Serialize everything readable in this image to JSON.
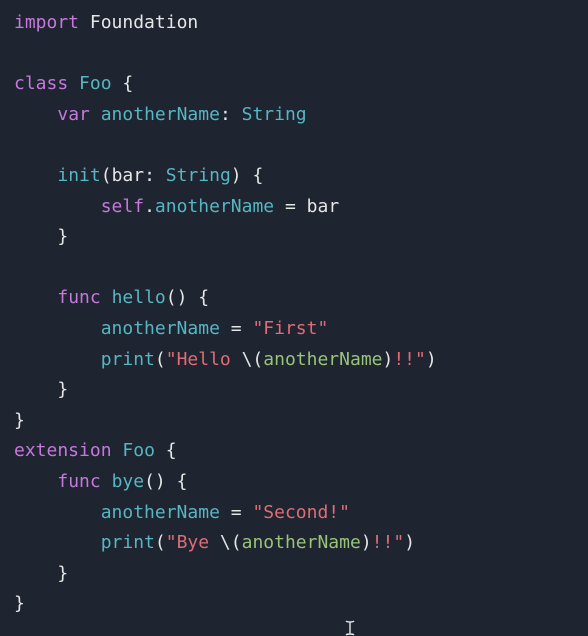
{
  "code": {
    "lines": [
      [
        {
          "t": "import",
          "c": "#c678dd"
        },
        {
          "t": " ",
          "c": "#e6e6e6"
        },
        {
          "t": "Foundation",
          "c": "#e6e6e6"
        }
      ],
      [],
      [
        {
          "t": "class",
          "c": "#c678dd"
        },
        {
          "t": " ",
          "c": "#e6e6e6"
        },
        {
          "t": "Foo",
          "c": "#56b6c2"
        },
        {
          "t": " ",
          "c": "#e6e6e6"
        },
        {
          "t": "{",
          "c": "#e6e6e6"
        }
      ],
      [
        {
          "t": "    ",
          "c": "#e6e6e6"
        },
        {
          "t": "var",
          "c": "#c678dd"
        },
        {
          "t": " ",
          "c": "#e6e6e6"
        },
        {
          "t": "anotherName",
          "c": "#56b6c2"
        },
        {
          "t": ": ",
          "c": "#e6e6e6"
        },
        {
          "t": "String",
          "c": "#56b6c2"
        }
      ],
      [],
      [
        {
          "t": "    ",
          "c": "#e6e6e6"
        },
        {
          "t": "init",
          "c": "#56b6c2"
        },
        {
          "t": "(",
          "c": "#e6e6e6"
        },
        {
          "t": "bar",
          "c": "#e6e6e6"
        },
        {
          "t": ": ",
          "c": "#e6e6e6"
        },
        {
          "t": "String",
          "c": "#56b6c2"
        },
        {
          "t": ") {",
          "c": "#e6e6e6"
        }
      ],
      [
        {
          "t": "        ",
          "c": "#e6e6e6"
        },
        {
          "t": "self",
          "c": "#c678dd"
        },
        {
          "t": ".",
          "c": "#e6e6e6"
        },
        {
          "t": "anotherName",
          "c": "#56b6c2"
        },
        {
          "t": " = ",
          "c": "#e6e6e6"
        },
        {
          "t": "bar",
          "c": "#e6e6e6"
        }
      ],
      [
        {
          "t": "    }",
          "c": "#e6e6e6"
        }
      ],
      [],
      [
        {
          "t": "    ",
          "c": "#e6e6e6"
        },
        {
          "t": "func",
          "c": "#c678dd"
        },
        {
          "t": " ",
          "c": "#e6e6e6"
        },
        {
          "t": "hello",
          "c": "#56b6c2"
        },
        {
          "t": "() {",
          "c": "#e6e6e6"
        }
      ],
      [
        {
          "t": "        ",
          "c": "#e6e6e6"
        },
        {
          "t": "anotherName",
          "c": "#56b6c2"
        },
        {
          "t": " = ",
          "c": "#e6e6e6"
        },
        {
          "t": "\"First\"",
          "c": "#e06c75"
        }
      ],
      [
        {
          "t": "        ",
          "c": "#e6e6e6"
        },
        {
          "t": "print",
          "c": "#56b6c2"
        },
        {
          "t": "(",
          "c": "#e6e6e6"
        },
        {
          "t": "\"Hello ",
          "c": "#e06c75"
        },
        {
          "t": "\\(",
          "c": "#e6e6e6"
        },
        {
          "t": "anotherName",
          "c": "#98c379"
        },
        {
          "t": ")",
          "c": "#e6e6e6"
        },
        {
          "t": "!!\"",
          "c": "#e06c75"
        },
        {
          "t": ")",
          "c": "#e6e6e6"
        }
      ],
      [
        {
          "t": "    }",
          "c": "#e6e6e6"
        }
      ],
      [
        {
          "t": "}",
          "c": "#e6e6e6"
        }
      ],
      [
        {
          "t": "extension",
          "c": "#c678dd"
        },
        {
          "t": " ",
          "c": "#e6e6e6"
        },
        {
          "t": "Foo",
          "c": "#56b6c2"
        },
        {
          "t": " {",
          "c": "#e6e6e6"
        }
      ],
      [
        {
          "t": "    ",
          "c": "#e6e6e6"
        },
        {
          "t": "func",
          "c": "#c678dd"
        },
        {
          "t": " ",
          "c": "#e6e6e6"
        },
        {
          "t": "bye",
          "c": "#56b6c2"
        },
        {
          "t": "() {",
          "c": "#e6e6e6"
        }
      ],
      [
        {
          "t": "        ",
          "c": "#e6e6e6"
        },
        {
          "t": "anotherName",
          "c": "#56b6c2"
        },
        {
          "t": " = ",
          "c": "#e6e6e6"
        },
        {
          "t": "\"Second!\"",
          "c": "#e06c75"
        }
      ],
      [
        {
          "t": "        ",
          "c": "#e6e6e6"
        },
        {
          "t": "print",
          "c": "#56b6c2"
        },
        {
          "t": "(",
          "c": "#e6e6e6"
        },
        {
          "t": "\"Bye ",
          "c": "#e06c75"
        },
        {
          "t": "\\(",
          "c": "#e6e6e6"
        },
        {
          "t": "anotherName",
          "c": "#98c379"
        },
        {
          "t": ")",
          "c": "#e6e6e6"
        },
        {
          "t": "!!\"",
          "c": "#e06c75"
        },
        {
          "t": ")",
          "c": "#e6e6e6"
        }
      ],
      [
        {
          "t": "    }",
          "c": "#e6e6e6"
        }
      ],
      [
        {
          "t": "}",
          "c": "#e6e6e6"
        }
      ]
    ]
  }
}
